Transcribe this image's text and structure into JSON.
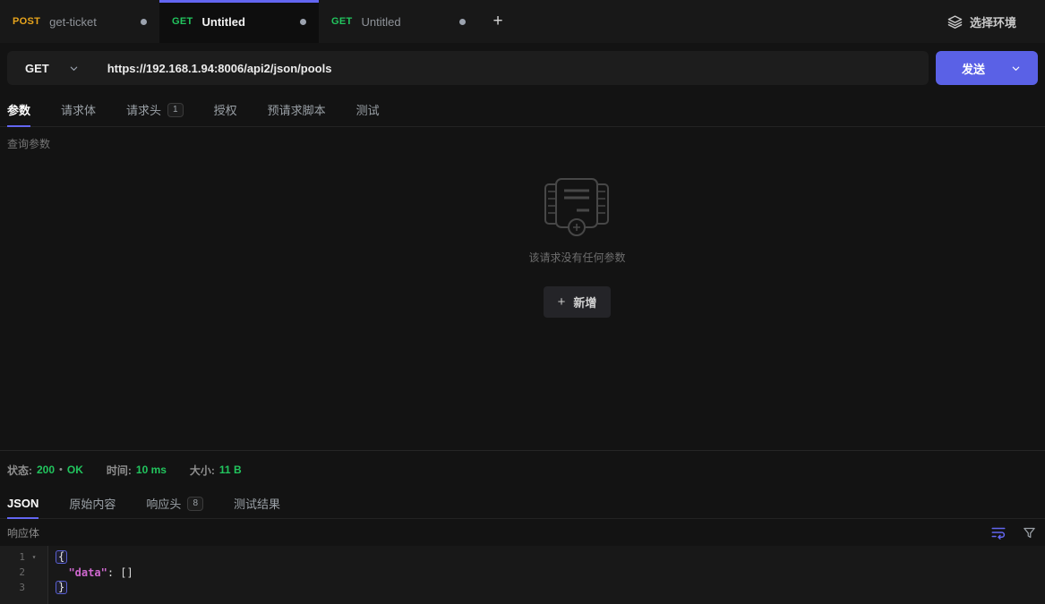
{
  "tabbar": {
    "tabs": [
      {
        "method": "POST",
        "name": "get-ticket"
      },
      {
        "method": "GET",
        "name": "Untitled"
      },
      {
        "method": "GET",
        "name": "Untitled"
      }
    ],
    "new_tab_glyph": "+",
    "env_label": "选择环境"
  },
  "request": {
    "method": "GET",
    "url": "https://192.168.1.94:8006/api2/json/pools",
    "send_label": "发送",
    "tabs": [
      {
        "label": "参数"
      },
      {
        "label": "请求体"
      },
      {
        "label": "请求头",
        "badge": "1"
      },
      {
        "label": "授权"
      },
      {
        "label": "预请求脚本"
      },
      {
        "label": "测试"
      }
    ],
    "section_label": "查询参数",
    "empty_text": "该请求没有任何参数",
    "add_glyph": "+",
    "add_label": "新增"
  },
  "response": {
    "status_label": "状态:",
    "status_code": "200",
    "status_sep": "•",
    "status_text": "OK",
    "time_label": "时间:",
    "time_value": "10 ms",
    "size_label": "大小:",
    "size_value": "11 B",
    "tabs": [
      {
        "label": "JSON"
      },
      {
        "label": "原始内容"
      },
      {
        "label": "响应头",
        "badge": "8"
      },
      {
        "label": "测试结果"
      }
    ],
    "body_label": "响应体",
    "code": {
      "fold_glyph": "▾",
      "lines": [
        {
          "num": "1",
          "open_bracket": "{"
        },
        {
          "num": "2",
          "indent": "  ",
          "key": "\"data\"",
          "rest": ": []"
        },
        {
          "num": "3",
          "close_bracket": "}"
        }
      ]
    }
  },
  "icons": {
    "env": "layers-icon",
    "method_caret": "chevron-down-icon",
    "send_caret": "chevron-down-icon",
    "wrap": "word-wrap-icon",
    "filter": "filter-funnel-icon",
    "empty": "empty-params-illustration"
  },
  "colors": {
    "accent": "#6366f1",
    "send_button": "#5a61e6",
    "get_method": "#22c55e",
    "post_method": "#e7a41c",
    "status_green": "#22c55e",
    "json_key": "#cf68cf"
  }
}
